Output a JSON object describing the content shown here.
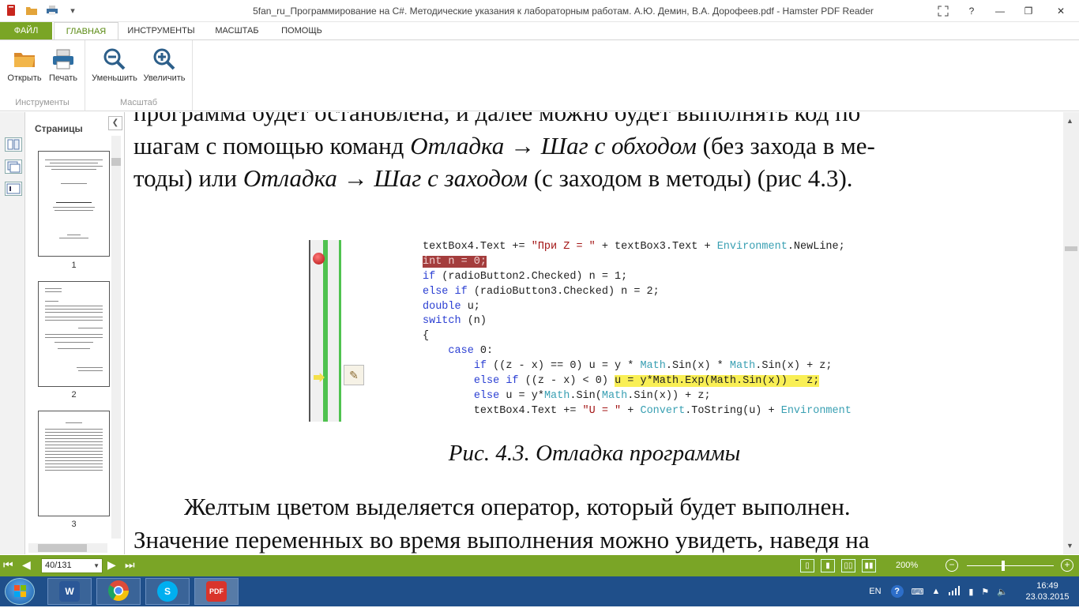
{
  "window": {
    "title": "5fan_ru_Программирование на C#. Методические указания к лабораторным работам. А.Ю. Демин, В.А. Дорофеев.pdf - Hamster PDF Reader",
    "controls": {
      "help": "?",
      "minimize": "—",
      "restore": "❐",
      "close": "✕"
    }
  },
  "ribbon": {
    "tabs": [
      "ФАЙЛ",
      "ГЛАВНАЯ",
      "ИНСТРУМЕНТЫ",
      "МАСШТАБ",
      "ПОМОЩЬ"
    ],
    "groups": [
      {
        "label": "Инструменты",
        "buttons": [
          "Открыть",
          "Печать"
        ]
      },
      {
        "label": "Масштаб",
        "buttons": [
          "Уменьшить",
          "Увеличить"
        ]
      }
    ]
  },
  "pages_panel": {
    "title": "Страницы",
    "thumbnails": [
      {
        "number": "1"
      },
      {
        "number": "2"
      },
      {
        "number": "3"
      }
    ]
  },
  "document": {
    "text_lines": [
      {
        "parts": [
          {
            "t": "программа будет остановлена, и далее можно будет выполнять код по",
            "i": false
          }
        ]
      },
      {
        "parts": [
          {
            "t": "шагам с помощью команд ",
            "i": false
          },
          {
            "t": "Отладка → Шаг с обходом",
            "i": true
          },
          {
            "t": " (без захода в ме-",
            "i": false
          }
        ]
      },
      {
        "parts": [
          {
            "t": "тоды) или ",
            "i": false
          },
          {
            "t": "Отладка → Шаг с заходом",
            "i": true
          },
          {
            "t": " (с заходом в методы) (рис 4.3).",
            "i": false
          }
        ]
      }
    ],
    "caption": "Рис. 4.3. Отладка программы",
    "after_lines": [
      {
        "parts": [
          {
            "t": "Желтым цветом выделяется оператор, который будет выполнен.",
            "i": false
          }
        ]
      },
      {
        "parts": [
          {
            "t": "Значение переменных во время выполнения можно увидеть, наведя на",
            "i": false
          }
        ]
      }
    ],
    "code_lines": [
      [
        {
          "t": "textBox4.Text += "
        },
        {
          "t": "\"При Z = \"",
          "c": "str"
        },
        {
          "t": " + textBox3.Text + "
        },
        {
          "t": "Environment",
          "c": "ty"
        },
        {
          "t": ".NewLine;"
        }
      ],
      [
        {
          "t": "int n = 0;",
          "c": "hlred"
        }
      ],
      [
        {
          "t": "if",
          "c": "kw"
        },
        {
          "t": " (radioButton2.Checked) n = 1;"
        }
      ],
      [
        {
          "t": "else if",
          "c": "kw"
        },
        {
          "t": " (radioButton3.Checked) n = 2;"
        }
      ],
      [
        {
          "t": "double",
          "c": "kw"
        },
        {
          "t": " u;"
        }
      ],
      [
        {
          "t": "switch",
          "c": "kw"
        },
        {
          "t": " (n)"
        }
      ],
      [
        {
          "t": "{"
        }
      ],
      [
        {
          "t": "    "
        },
        {
          "t": "case",
          "c": "kw"
        },
        {
          "t": " 0:"
        }
      ],
      [
        {
          "t": "        "
        },
        {
          "t": "if",
          "c": "kw"
        },
        {
          "t": " ((z - x) == 0) u = y * "
        },
        {
          "t": "Math",
          "c": "ty"
        },
        {
          "t": ".Sin(x) * "
        },
        {
          "t": "Math",
          "c": "ty"
        },
        {
          "t": ".Sin(x) + z;"
        }
      ],
      [
        {
          "t": "        "
        },
        {
          "t": "else if",
          "c": "kw"
        },
        {
          "t": " ((z - x) < 0) "
        },
        {
          "t": "u = y*Math.Exp(Math.Sin(x)) - z;",
          "c": "hlyel"
        }
      ],
      [
        {
          "t": "        "
        },
        {
          "t": "else",
          "c": "kw"
        },
        {
          "t": " u = y*"
        },
        {
          "t": "Math",
          "c": "ty"
        },
        {
          "t": ".Sin("
        },
        {
          "t": "Math",
          "c": "ty"
        },
        {
          "t": ".Sin(x)) + z;"
        }
      ],
      [
        {
          "t": "        textBox4.Text += "
        },
        {
          "t": "\"U = \"",
          "c": "str"
        },
        {
          "t": " + "
        },
        {
          "t": "Convert",
          "c": "ty"
        },
        {
          "t": ".ToString(u) + "
        },
        {
          "t": "Environment",
          "c": "ty"
        }
      ]
    ]
  },
  "statusbar": {
    "page_value": "40/131",
    "zoom": "200%",
    "zoom_level_fraction": 0.42
  },
  "taskbar": {
    "apps": [
      {
        "name": "Word",
        "glyph": "W",
        "color": "#2b5797"
      },
      {
        "name": "Chrome",
        "glyph": "",
        "color": "#dd4b39"
      },
      {
        "name": "Skype",
        "glyph": "S",
        "color": "#00aff0"
      },
      {
        "name": "PDF",
        "glyph": "PDF",
        "color": "#d9342b"
      }
    ],
    "language": "EN",
    "time": "16:49",
    "date": "23.03.2015"
  },
  "colors": {
    "accent": "#7aa526",
    "taskbar": "#1f4f8a"
  }
}
